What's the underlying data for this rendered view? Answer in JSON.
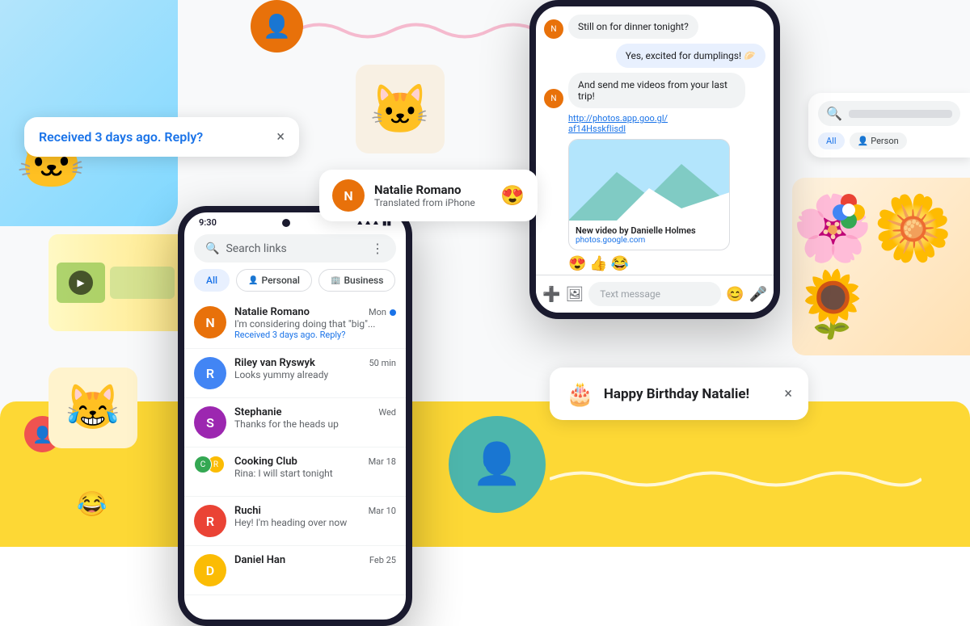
{
  "background": "#f8f9fa",
  "colors": {
    "blue": "#1a73e8",
    "orange": "#e8710a",
    "teal": "#4db6ac",
    "yellow": "#fdd835",
    "green": "#34a853"
  },
  "notif_received": {
    "text": "Received 3 days ago. Reply?",
    "close": "×"
  },
  "natalie_card": {
    "name": "Natalie Romano",
    "subtitle": "Translated from iPhone",
    "emoji": "😍"
  },
  "birthday_card": {
    "emoji": "🎂",
    "text": "Happy Birthday Natalie!",
    "close": "×"
  },
  "phone": {
    "status_time": "9:30",
    "search_placeholder": "Search links",
    "tabs": [
      "All",
      "Personal",
      "Business"
    ],
    "conversations": [
      {
        "name": "Natalie Romano",
        "time": "Mon",
        "message": "I'm considering doing that \"big\"...",
        "reply": "Received 3 days ago. Reply?",
        "unread": true,
        "avatar_color": "#e8710a",
        "initials": "N"
      },
      {
        "name": "Riley van Ryswyk",
        "time": "50 min",
        "message": "Looks yummy already",
        "unread": false,
        "avatar_color": "#4285f4",
        "initials": "R"
      },
      {
        "name": "Stephanie",
        "time": "Wed",
        "message": "Thanks for the heads up",
        "unread": false,
        "avatar_color": "#9c27b0",
        "initials": "S"
      },
      {
        "name": "Cooking Club",
        "time": "Mar 18",
        "message": "Rina: I will start tonight",
        "unread": false,
        "avatar_color": "#34a853",
        "initials": "C",
        "group": true
      },
      {
        "name": "Ruchi",
        "time": "Mar 10",
        "message": "Hey! I'm heading over now",
        "unread": false,
        "avatar_color": "#ea4335",
        "initials": "R"
      },
      {
        "name": "Daniel Han",
        "time": "Feb 25",
        "message": "",
        "unread": false,
        "avatar_color": "#fbbc04",
        "initials": "D"
      }
    ]
  },
  "chat": {
    "messages": [
      {
        "text": "Still on for dinner tonight?",
        "type": "received"
      },
      {
        "text": "Yes, excited for dumplings! 🥟",
        "type": "sent"
      },
      {
        "text": "And send me videos from your last trip!",
        "type": "received"
      },
      {
        "link": "http://photos.app.goo.gl/af14HsskfIisdl",
        "type": "link_card"
      },
      {
        "card_title": "New video by Danielle Holmes",
        "card_subtitle": "photos.google.com",
        "type": "image_card"
      },
      {
        "reactions": "😍👍😂",
        "type": "reactions"
      }
    ],
    "input_placeholder": "Text message"
  },
  "search_card": {
    "placeholder": "🔍",
    "tabs": [
      "All",
      "Person"
    ]
  },
  "stickers": {
    "cat_cowboy": "🐱",
    "cat_crying": "😹"
  }
}
